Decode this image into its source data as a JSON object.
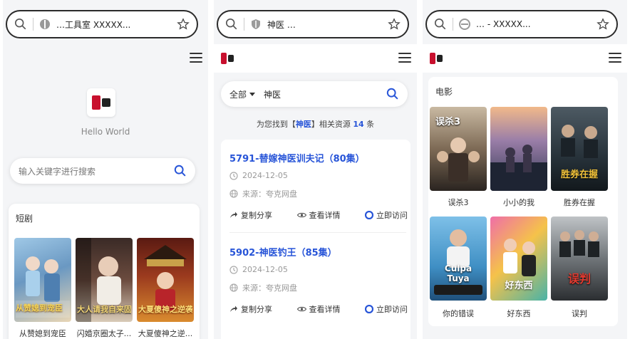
{
  "panels": [
    {
      "url": "…工具室 XXXXX...",
      "home": {
        "hello": "Hello World",
        "search_placeholder": "输入关键字进行搜索",
        "section_title": "短剧",
        "items": [
          {
            "title": "从赞媳到宠臣",
            "overlay": "从赞媳到宠臣"
          },
          {
            "title": "闪婚京圈太子...",
            "overlay": "大人请我自来固"
          },
          {
            "title": "大夏傻神之逆...",
            "overlay": "大夏傻神之逆袭"
          }
        ]
      }
    },
    {
      "url": "神医 …",
      "search": {
        "scope": "全部",
        "query": "神医"
      },
      "found": {
        "pre": "为您找到【",
        "term": "神医",
        "mid": "】相关资源 ",
        "count": "14",
        "post": " 条"
      },
      "results": [
        {
          "title": "5791-替嫁神医训夫记（80集）",
          "date": "2024-12-05",
          "source": "来源：夸克网盘",
          "share": "复制分享",
          "detail": "查看详情",
          "visit": "立即访问"
        },
        {
          "title": "5902-神医钓王（85集）",
          "date": "2024-12-05",
          "source": "来源：夸克网盘",
          "share": "复制分享",
          "detail": "查看详情",
          "visit": "立即访问"
        }
      ]
    },
    {
      "url": "… - XXXXX...",
      "section_title": "电影",
      "movies": [
        {
          "title": "误杀3",
          "overlay": "误杀3"
        },
        {
          "title": "小小的我",
          "overlay": ""
        },
        {
          "title": "胜券在握",
          "overlay": "胜券在握"
        },
        {
          "title": "你的错误",
          "overlay": "Culpa Tuya"
        },
        {
          "title": "好东西",
          "overlay": "好东西"
        },
        {
          "title": "误判",
          "overlay": "误判"
        }
      ]
    }
  ],
  "colors": {
    "accent": "#2855d8",
    "background": "#f4f5f7"
  }
}
